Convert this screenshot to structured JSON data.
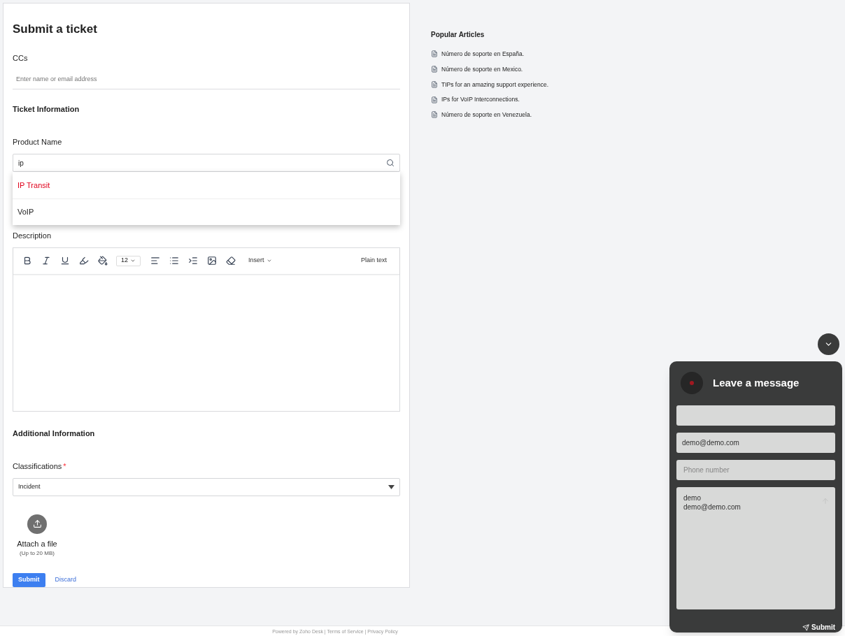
{
  "form": {
    "title": "Submit a ticket",
    "ccs": {
      "label": "CCs",
      "placeholder": "Enter name or email address"
    },
    "ticket_section": "Ticket Information",
    "product": {
      "label": "Product Name",
      "value": "ip",
      "suggestions": [
        {
          "label": "IP Transit",
          "selected": true
        },
        {
          "label": "VoIP",
          "selected": false
        }
      ]
    },
    "description": {
      "label": "Description",
      "font_size": "12",
      "insert": "Insert",
      "plain_text": "Plain text"
    },
    "additional_section": "Additional Information",
    "classifications": {
      "label": "Classifications",
      "required_mark": "*",
      "value": "Incident"
    },
    "attach": {
      "label": "Attach a file",
      "limit": "(Up to 20 MB)"
    },
    "buttons": {
      "submit": "Submit",
      "discard": "Discard"
    }
  },
  "popular": {
    "title": "Popular Articles",
    "articles": [
      "Número de soporte en España.",
      "Número de soporte en Mexico.",
      "TIPs for an amazing support experience.",
      "IPs for VoIP Interconnections.",
      "Número de soporte en Venezuela."
    ]
  },
  "chat": {
    "title": "Leave a message",
    "email": "demo@demo.com",
    "phone_placeholder": "Phone number",
    "message": "demo\ndemo@demo.com",
    "submit": "Submit"
  },
  "footer": "Powered by Zoho Desk | Terms of Service | Privacy Policy"
}
